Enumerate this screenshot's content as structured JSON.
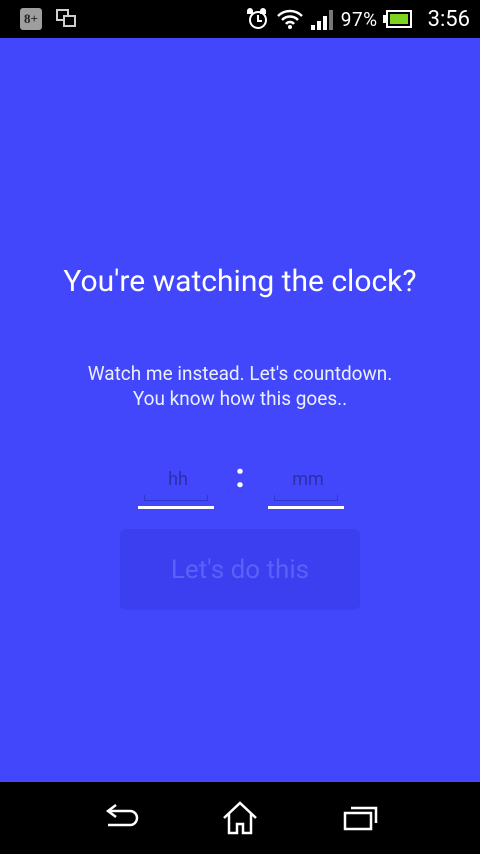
{
  "statusbar": {
    "battery_percent": "97%",
    "time": "3:56",
    "icons": [
      "google-plus-icon",
      "screens-icon",
      "alarm-icon",
      "wifi-icon",
      "signal-icon",
      "battery-icon"
    ]
  },
  "main": {
    "background_color": "#4247fb",
    "headline": "You're watching the clock?",
    "subtext_line1": "Watch me instead. Let's countdown.",
    "subtext_line2": "You know how this goes..",
    "hours_placeholder": "hh",
    "colon": ":",
    "minutes_placeholder": "mm",
    "start_button_label": "Let's do this"
  },
  "navbar": {
    "icons": [
      "back-icon",
      "home-icon",
      "recents-icon"
    ]
  }
}
